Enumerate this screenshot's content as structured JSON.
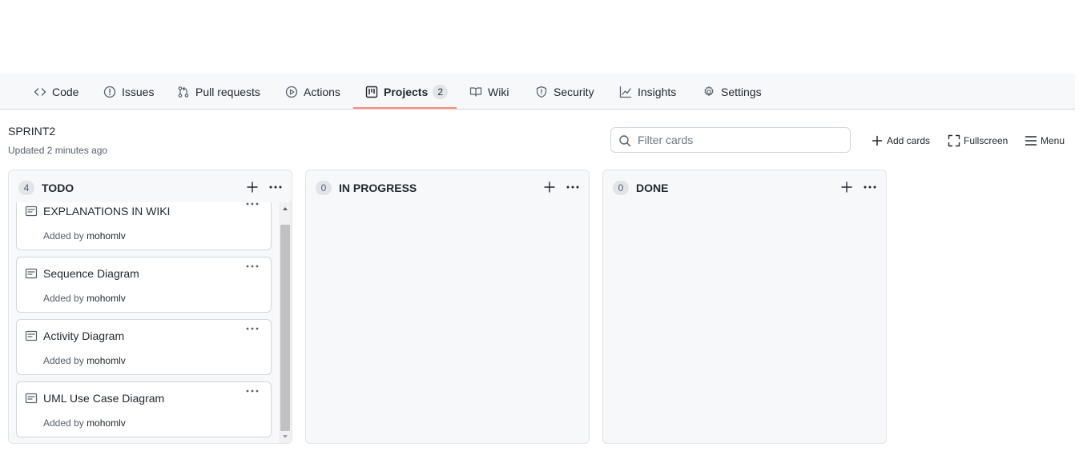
{
  "nav": {
    "items": [
      {
        "label": "Code",
        "icon": "code-icon"
      },
      {
        "label": "Issues",
        "icon": "issue-opened-icon"
      },
      {
        "label": "Pull requests",
        "icon": "git-pull-request-icon"
      },
      {
        "label": "Actions",
        "icon": "play-icon"
      },
      {
        "label": "Projects",
        "icon": "project-icon",
        "counter": "2",
        "selected": true
      },
      {
        "label": "Wiki",
        "icon": "book-icon"
      },
      {
        "label": "Security",
        "icon": "shield-icon"
      },
      {
        "label": "Insights",
        "icon": "graph-icon"
      },
      {
        "label": "Settings",
        "icon": "gear-icon"
      }
    ]
  },
  "board": {
    "title": "SPRINT2",
    "updated": "Updated 2 minutes ago",
    "filter_placeholder": "Filter cards",
    "add_cards_label": "Add cards",
    "fullscreen_label": "Fullscreen",
    "menu_label": "Menu"
  },
  "columns": [
    {
      "count": "4",
      "name": "TODO",
      "cards": [
        {
          "title": "EXPLANATIONS IN WIKI",
          "added_by_prefix": "Added by",
          "author": "mohomlv"
        },
        {
          "title": "Sequence Diagram",
          "added_by_prefix": "Added by",
          "author": "mohomlv"
        },
        {
          "title": "Activity Diagram",
          "added_by_prefix": "Added by",
          "author": "mohomlv"
        },
        {
          "title": "UML Use Case Diagram",
          "added_by_prefix": "Added by",
          "author": "mohomlv"
        }
      ]
    },
    {
      "count": "0",
      "name": "IN PROGRESS",
      "cards": []
    },
    {
      "count": "0",
      "name": "DONE",
      "cards": []
    }
  ],
  "colors": {
    "accent_underline": "#fd8c73",
    "column_bg": "#f6f8fa",
    "border": "#d0d7de",
    "muted_text": "#57606a"
  }
}
